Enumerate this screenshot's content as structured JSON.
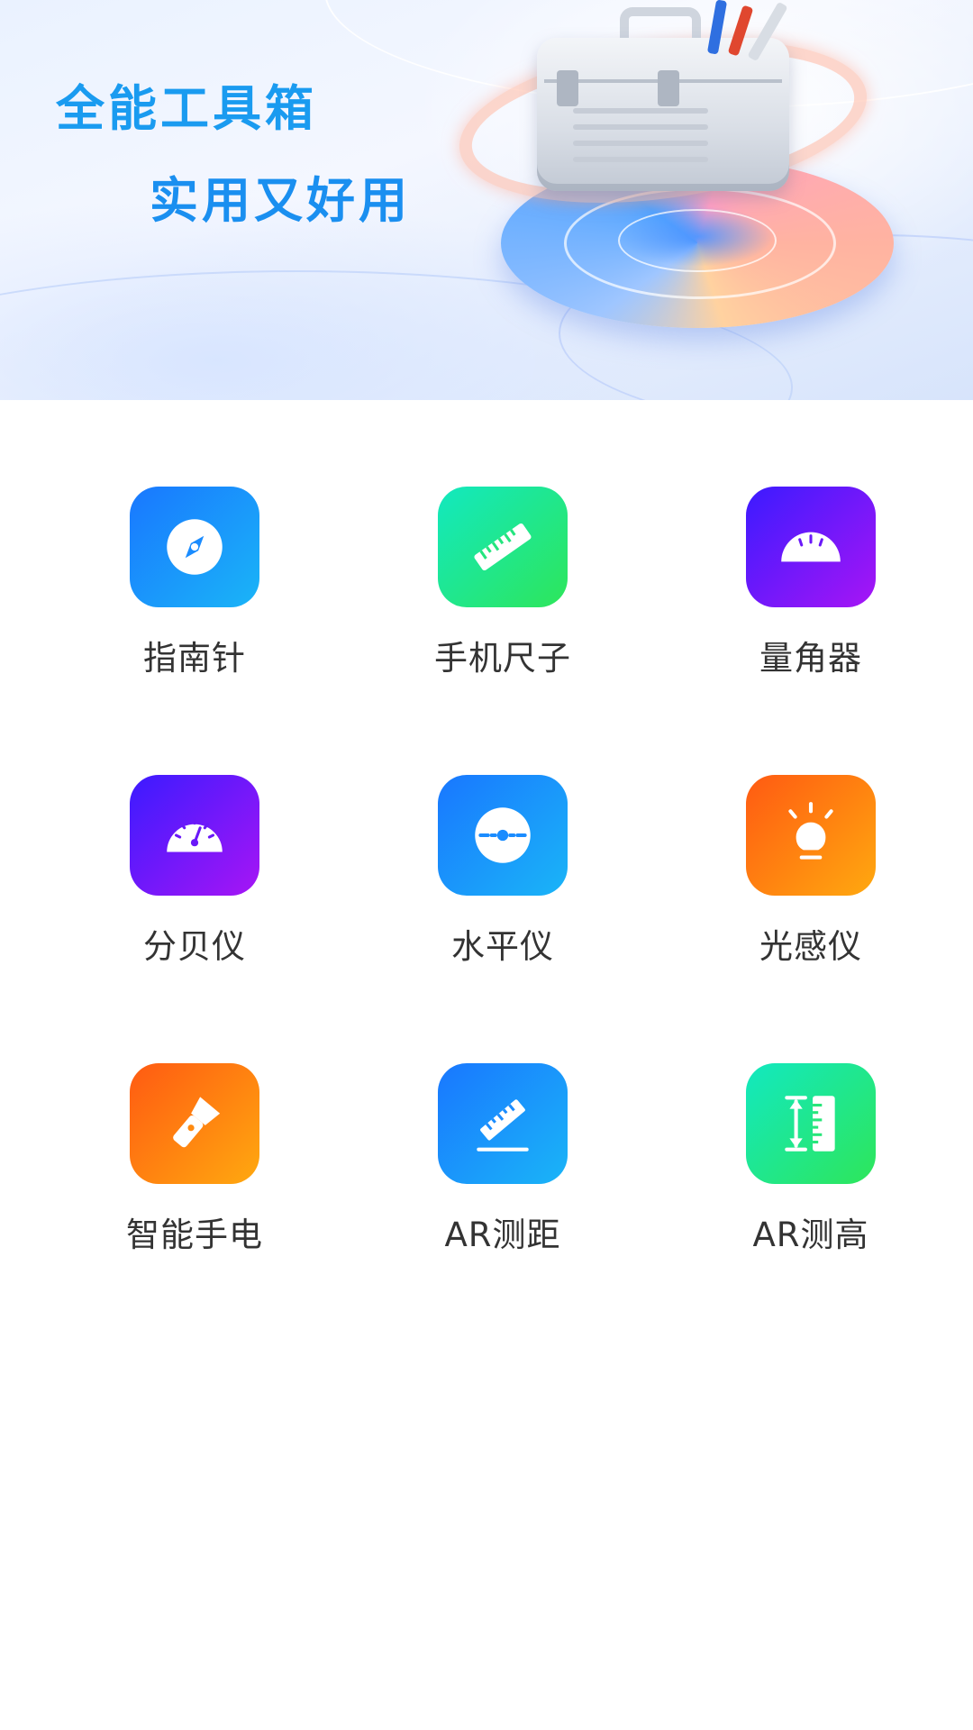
{
  "banner": {
    "title": "全能工具箱",
    "subtitle": "实用又好用"
  },
  "tools": [
    {
      "label": "指南针",
      "icon": "compass-icon",
      "color": "#1a8cff"
    },
    {
      "label": "手机尺子",
      "icon": "ruler-icon",
      "color": "#1ee88a"
    },
    {
      "label": "量角器",
      "icon": "protractor-icon",
      "color": "#6a18f8"
    },
    {
      "label": "分贝仪",
      "icon": "decibel-gauge-icon",
      "color": "#6a18f8"
    },
    {
      "label": "水平仪",
      "icon": "level-icon",
      "color": "#1a8cff"
    },
    {
      "label": "光感仪",
      "icon": "light-bulb-icon",
      "color": "#ff7d10"
    },
    {
      "label": "智能手电",
      "icon": "flashlight-icon",
      "color": "#ff7d10"
    },
    {
      "label": "AR测距",
      "icon": "ar-distance-icon",
      "color": "#1a8cff"
    },
    {
      "label": "AR测高",
      "icon": "ar-height-icon",
      "color": "#1ee88a"
    }
  ]
}
